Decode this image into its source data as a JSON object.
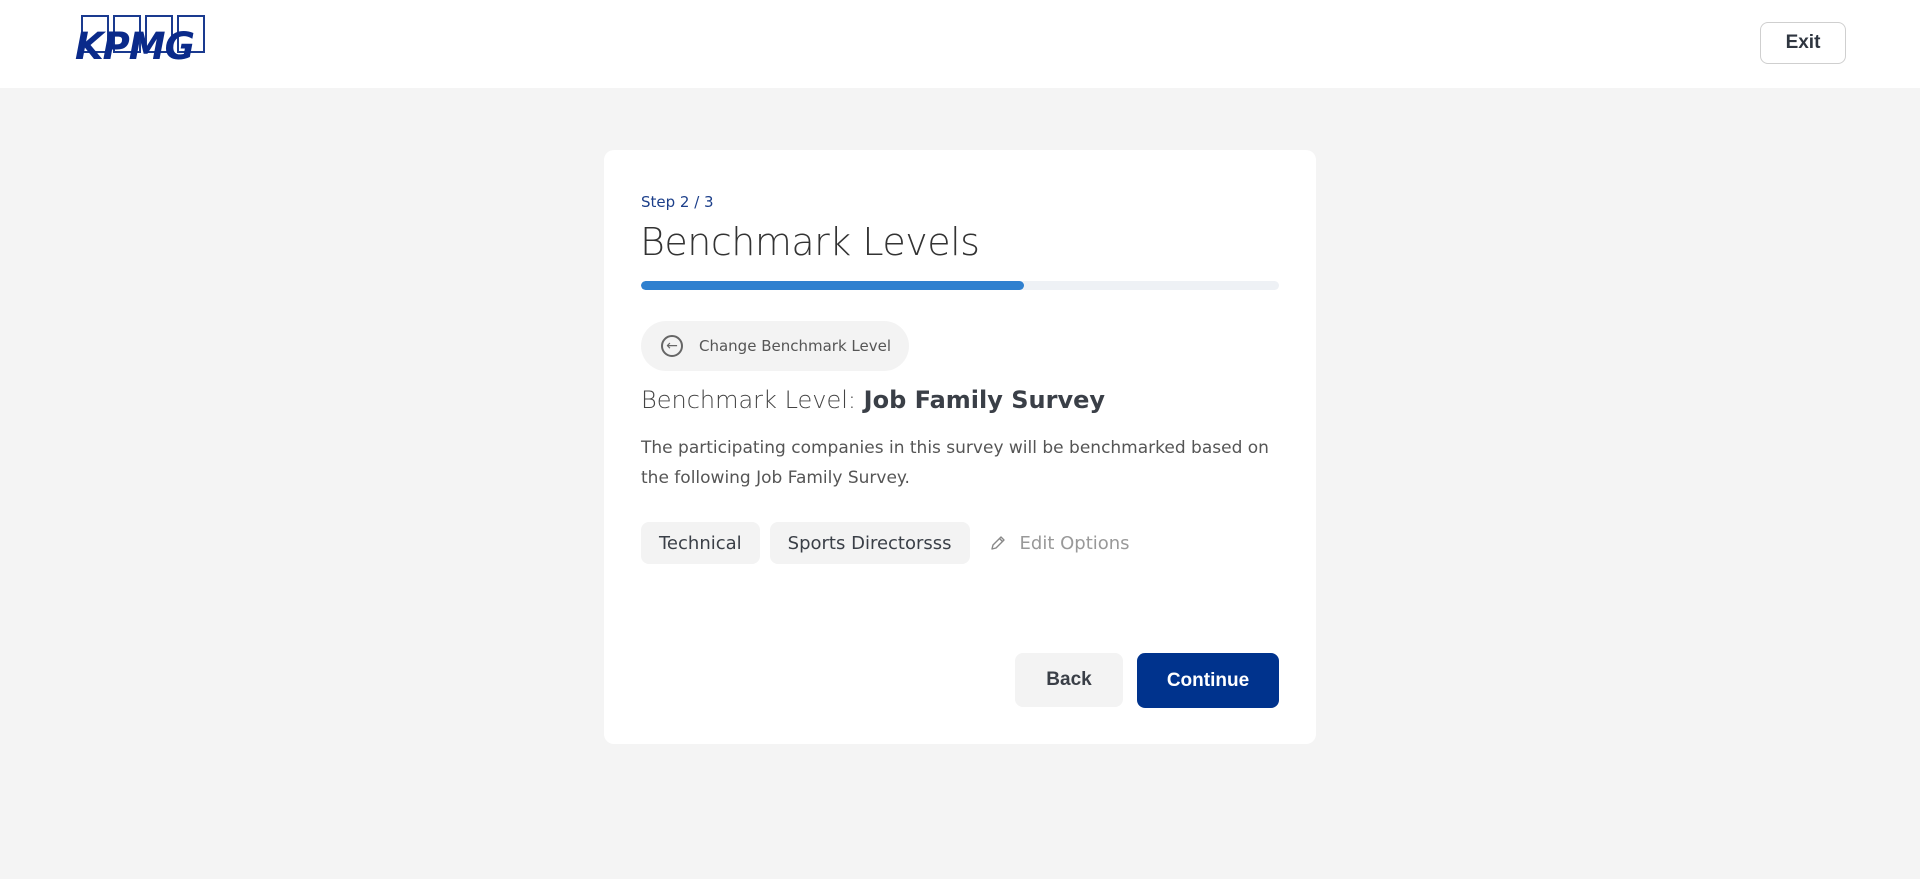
{
  "header": {
    "logo_text": "KPMG",
    "exit_label": "Exit"
  },
  "wizard": {
    "step_label": "Step 2 / 3",
    "title": "Benchmark Levels",
    "progress_fraction": 0.6,
    "change_level_label": "Change Benchmark Level",
    "level_prefix": "Benchmark Level:",
    "level_value": "Job Family Survey",
    "description": "The participating companies in this survey will be benchmarked based on the following Job Family Survey.",
    "chips": [
      "Technical",
      "Sports Directorsss"
    ],
    "edit_options_label": "Edit Options",
    "back_label": "Back",
    "continue_label": "Continue"
  },
  "colors": {
    "brand": "#00338d",
    "progress": "#2f80cf",
    "background": "#f4f4f4"
  }
}
